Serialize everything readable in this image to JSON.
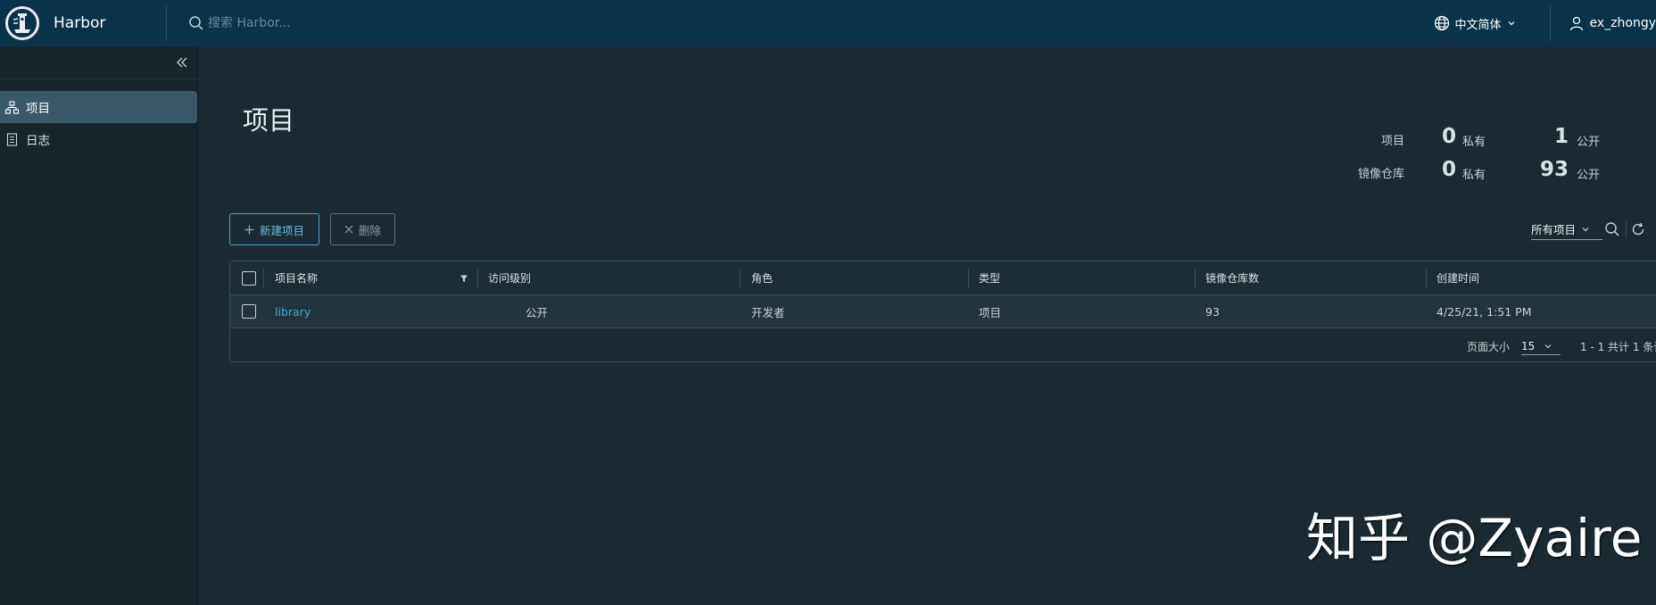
{
  "header": {
    "brand": "Harbor",
    "search_placeholder": "搜索 Harbor...",
    "language": "中文简体",
    "user": "ex_zhongy"
  },
  "sidebar": {
    "items": [
      {
        "label": "项目",
        "icon": "projects-icon",
        "active": true
      },
      {
        "label": "日志",
        "icon": "logs-icon",
        "active": false
      }
    ]
  },
  "main": {
    "title": "项目",
    "stats": {
      "projects_label": "项目",
      "repos_label": "镜像仓库",
      "private_label": "私有",
      "public_label": "公开",
      "projects_private": "0",
      "projects_public": "1",
      "repos_private": "0",
      "repos_public": "93"
    },
    "toolbar": {
      "new_project": "新建项目",
      "delete": "删除",
      "filter": "所有项目"
    },
    "table": {
      "columns": [
        "项目名称",
        "访问级别",
        "角色",
        "类型",
        "镜像仓库数",
        "创建时间"
      ],
      "rows": [
        {
          "name": "library",
          "access": "公开",
          "role": "开发者",
          "type": "项目",
          "repo_count": "93",
          "created": "4/25/21, 1:51 PM"
        }
      ]
    },
    "footer": {
      "page_size_label": "页面大小",
      "page_size": "15",
      "summary": "1 - 1 共计 1 条记"
    }
  },
  "watermark": "知乎 @Zyaire",
  "colors": {
    "header_bg": "#0a3248",
    "body_bg": "#1b2a32",
    "sidebar_bg": "#17242b",
    "active_item_bg": "#3b5868",
    "link": "#4aa7dc",
    "primary_outline": "#4aa1cc"
  }
}
